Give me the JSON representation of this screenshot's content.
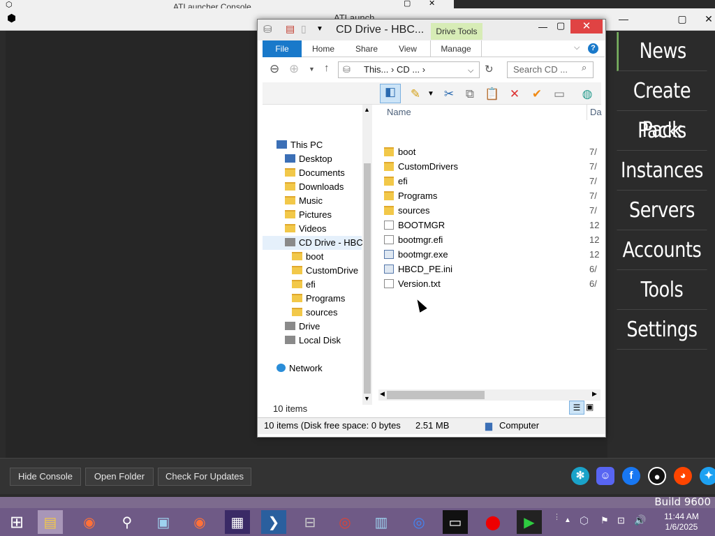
{
  "launcher": {
    "title": "ATLauncher Console",
    "app_title": "ATLaunch",
    "nav": [
      "News",
      "Create Pack",
      "Packs",
      "Instances",
      "Servers",
      "Accounts",
      "Tools",
      "Settings"
    ],
    "buttons": {
      "hide_console": "Hide Console",
      "open_folder": "Open Folder",
      "check_updates": "Check For Updates"
    },
    "socials": [
      "cursforge-icon",
      "discord-icon",
      "facebook-icon",
      "github-icon",
      "reddit-icon",
      "twitter-icon"
    ]
  },
  "explorer": {
    "title": "CD Drive - HBC...",
    "contextual_tab": "Drive Tools",
    "ribbon_tabs": {
      "file": "File",
      "home": "Home",
      "share": "Share",
      "view": "View",
      "manage": "Manage"
    },
    "address": "This... › CD ... ›",
    "search_placeholder": "Search CD ...",
    "nav_items": {
      "this_pc": "This PC",
      "desktop": "Desktop",
      "documents": "Documents",
      "downloads": "Downloads",
      "music": "Music",
      "pictures": "Pictures",
      "videos": "Videos",
      "cd_drive": "CD Drive - HBC",
      "boot": "boot",
      "customdrivers": "CustomDrive",
      "efi": "efi",
      "programs": "Programs",
      "sources": "sources",
      "drive": "Drive",
      "local_disk": "Local Disk",
      "network": "Network"
    },
    "column_name": "Name",
    "column_date": "Da",
    "files": [
      {
        "name": "boot",
        "date": "7/"
      },
      {
        "name": "CustomDrivers",
        "date": "7/"
      },
      {
        "name": "efi",
        "date": "7/"
      },
      {
        "name": "Programs",
        "date": "7/"
      },
      {
        "name": "sources",
        "date": "7/"
      },
      {
        "name": "BOOTMGR",
        "date": "12"
      },
      {
        "name": "bootmgr.efi",
        "date": "12"
      },
      {
        "name": "bootmgr.exe",
        "date": "12"
      },
      {
        "name": "HBCD_PE.ini",
        "date": "6/"
      },
      {
        "name": "Version.txt",
        "date": "6/"
      }
    ],
    "item_count": "10 items",
    "status_left": "10 items (Disk free space: 0 bytes",
    "status_size": "2.51 MB",
    "status_location": "Computer"
  },
  "taskbar": {
    "build": "Build 9600",
    "time": "11:44 AM",
    "date": "1/6/2025"
  }
}
